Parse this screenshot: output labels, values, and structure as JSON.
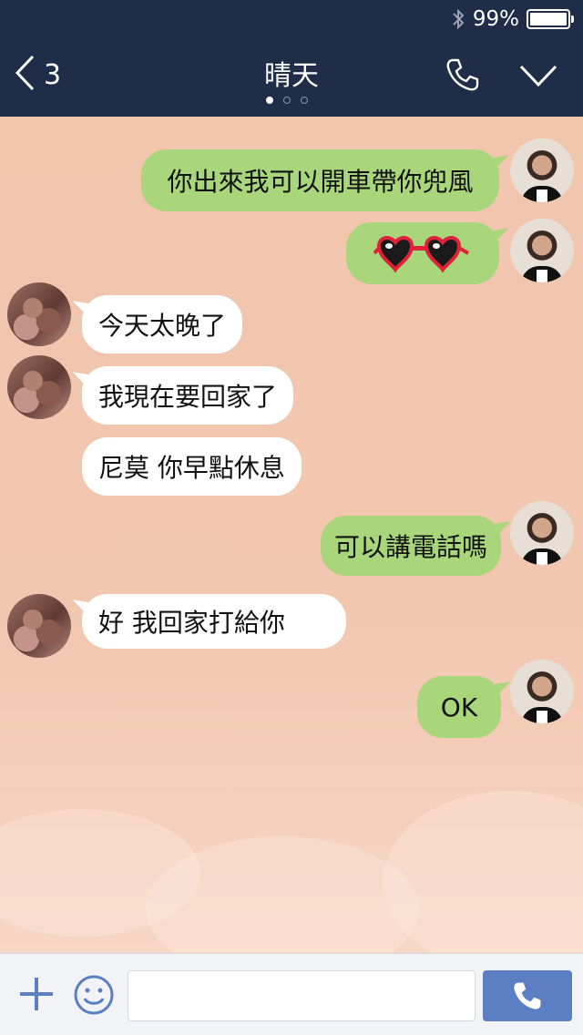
{
  "status_bar": {
    "battery_percent": "99%",
    "battery_level": 0.99,
    "icons": [
      "bluetooth-icon",
      "battery-icon"
    ]
  },
  "header": {
    "back_count": "3",
    "title": "晴天",
    "page_dots": 3,
    "active_dot": 0,
    "icons": [
      "back-chevron-icon",
      "phone-icon",
      "chevron-down-icon"
    ]
  },
  "messages": [
    {
      "side": "out",
      "text": "你出來我可以開車帶你兜風"
    },
    {
      "side": "out",
      "sticker": "heart-sunglasses-icon",
      "text": ""
    },
    {
      "side": "in",
      "text": "今天太晚了"
    },
    {
      "side": "in",
      "text": "我現在要回家了"
    },
    {
      "side": "in",
      "text": "尼莫 你早點休息"
    },
    {
      "side": "out",
      "text": "可以講電話嗎"
    },
    {
      "side": "in",
      "text": "好 我回家打給你"
    },
    {
      "side": "out",
      "text": "OK"
    }
  ],
  "composer": {
    "input_value": "",
    "placeholder": "",
    "icons": [
      "plus-icon",
      "smiley-icon",
      "phone-icon"
    ]
  },
  "colors": {
    "header_bg": "#1f2d48",
    "chat_bg": "#f2c6ae",
    "outgoing_bubble": "#a9d67b",
    "incoming_bubble": "#ffffff",
    "call_button": "#5b7fc2"
  }
}
